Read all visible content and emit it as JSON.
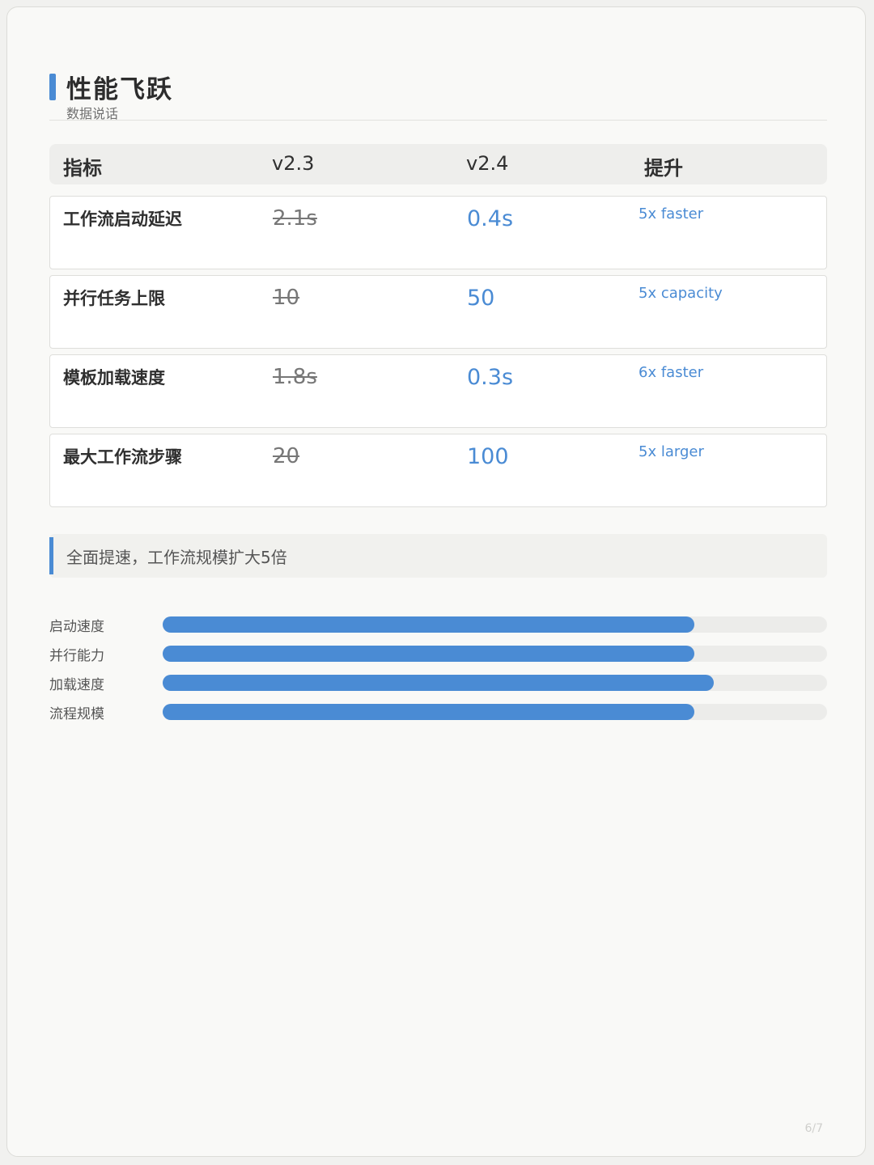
{
  "header": {
    "title": "性能飞跃",
    "subtitle": "数据说话"
  },
  "table": {
    "columns": [
      "指标",
      "v2.3",
      "v2.4",
      "提升"
    ],
    "rows": [
      {
        "metric": "工作流启动延迟",
        "old": "2.1s",
        "new": "0.4s",
        "gain": "5x faster"
      },
      {
        "metric": "并行任务上限",
        "old": "10",
        "new": "50",
        "gain": "5x capacity"
      },
      {
        "metric": "模板加载速度",
        "old": "1.8s",
        "new": "0.3s",
        "gain": "6x faster"
      },
      {
        "metric": "最大工作流步骤",
        "old": "20",
        "new": "100",
        "gain": "5x larger"
      }
    ]
  },
  "callout": {
    "text": "全面提速，工作流规模扩大5倍"
  },
  "bars": [
    {
      "label": "启动速度",
      "value": 0.8
    },
    {
      "label": "并行能力",
      "value": 0.8
    },
    {
      "label": "加载速度",
      "value": 0.83
    },
    {
      "label": "流程规模",
      "value": 0.8
    }
  ],
  "colors": {
    "accent": "#4a8bd4",
    "track": "#ececea"
  },
  "footer": {
    "page": "6/7"
  }
}
